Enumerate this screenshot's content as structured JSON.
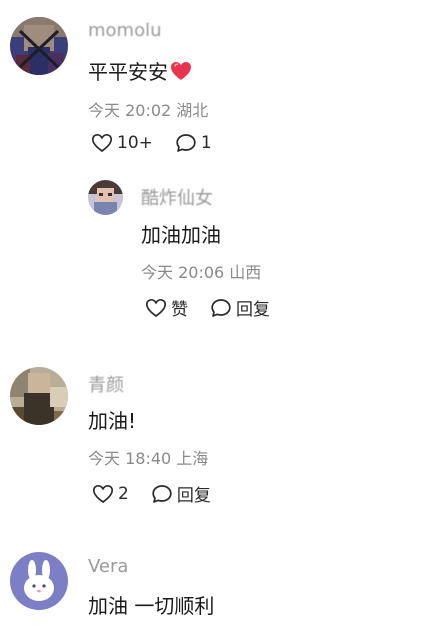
{
  "comments": [
    {
      "username": "momolu",
      "text": "平平安安",
      "time": "今天 20:02",
      "location": "湖北",
      "like_count": "10+",
      "reply_count": "1",
      "replies": [
        {
          "username": "酷炸仙女",
          "text": "加油加油",
          "time": "今天 20:06",
          "location": "山西",
          "like_label": "赞",
          "reply_label": "回复"
        }
      ]
    },
    {
      "username": "青颜",
      "text": "加油!",
      "time": "今天 18:40",
      "location": "上海",
      "like_count": "2",
      "reply_label": "回复"
    },
    {
      "username": "Vera",
      "text": "加油 一切顺利"
    }
  ],
  "colors": {
    "meta_text": "#8a8a8a",
    "username_text": "#9a9a9a",
    "heart_emoji": "#e8354f"
  }
}
